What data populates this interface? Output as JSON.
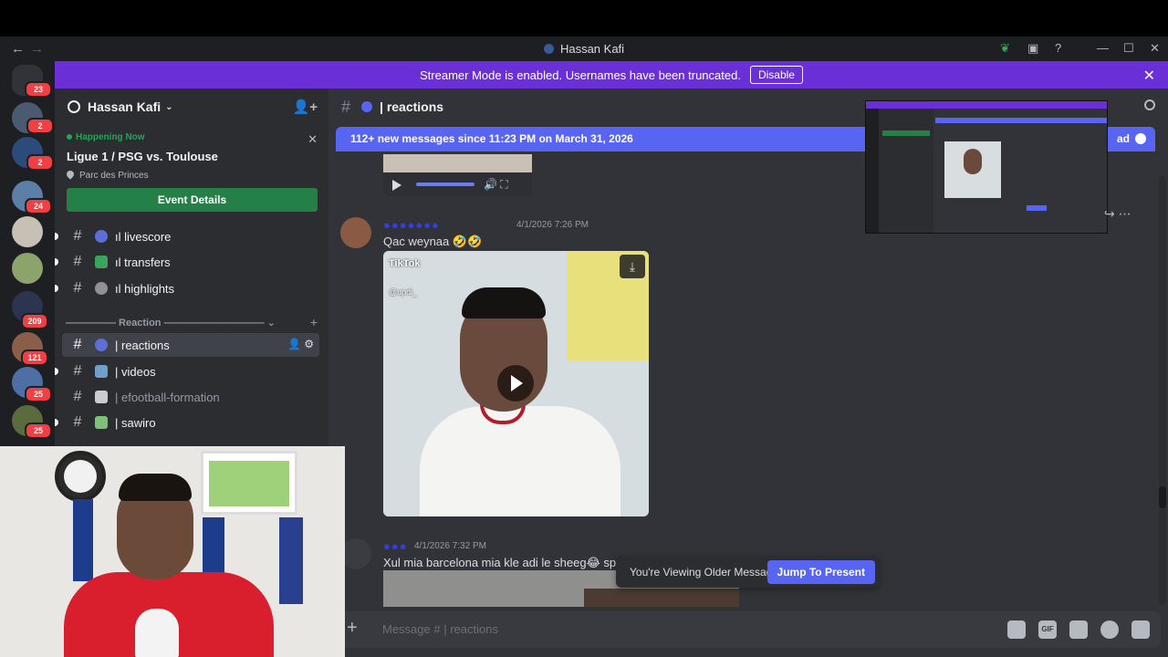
{
  "window": {
    "title": "Hassan Kafi"
  },
  "rail": {
    "badges": [
      "23",
      "2",
      "2",
      "24",
      "209",
      "121",
      "25",
      "25"
    ]
  },
  "banner": {
    "text": "Streamer Mode is enabled. Usernames have been truncated.",
    "disable_label": "Disable"
  },
  "guild": {
    "name": "Hassan Kafi"
  },
  "event": {
    "status": "Happening Now",
    "title": "Ligue 1 / PSG vs. Toulouse",
    "location": "Parc des Princes",
    "button": "Event Details"
  },
  "channels": {
    "top": [
      {
        "label": "ıl livescore"
      },
      {
        "label": "ıl transfers"
      },
      {
        "label": "ıl highlights"
      }
    ],
    "category": "————— Reaction ——————————",
    "list": [
      {
        "label": "| reactions"
      },
      {
        "label": "| videos"
      },
      {
        "label": "| efootball-formation"
      },
      {
        "label": "| sawiro"
      }
    ]
  },
  "chat": {
    "channel_name": "| reactions",
    "new_messages": "112+ new messages since 11:23 PM on March 31, 2026",
    "mark_read": "ad",
    "messages": [
      {
        "username": "●●●●●●●",
        "timestamp": "4/1/2026 7:26 PM",
        "text": "Qac weynaa 🤣🤣",
        "tiktok": "TikTok",
        "tiktok_user": "@updi_"
      },
      {
        "username": "●●●",
        "timestamp": "4/1/2026 7:32 PM",
        "text": "Xul mia barcelona mia kle adi le sheeg😂 spei"
      }
    ],
    "older_notice": "You're Viewing Older Messages",
    "jump_label": "Jump To Present",
    "composer_placeholder": "Message # | reactions",
    "composer_tools": [
      "gift-icon",
      "gif-icon",
      "sticker-icon",
      "emoji-icon",
      "apps-icon"
    ],
    "gif_label": "GIF"
  },
  "colors": {
    "accent": "#5865f2",
    "streamer_banner": "#6a2fd6",
    "event_button": "#248046",
    "badge": "#f23f43"
  }
}
